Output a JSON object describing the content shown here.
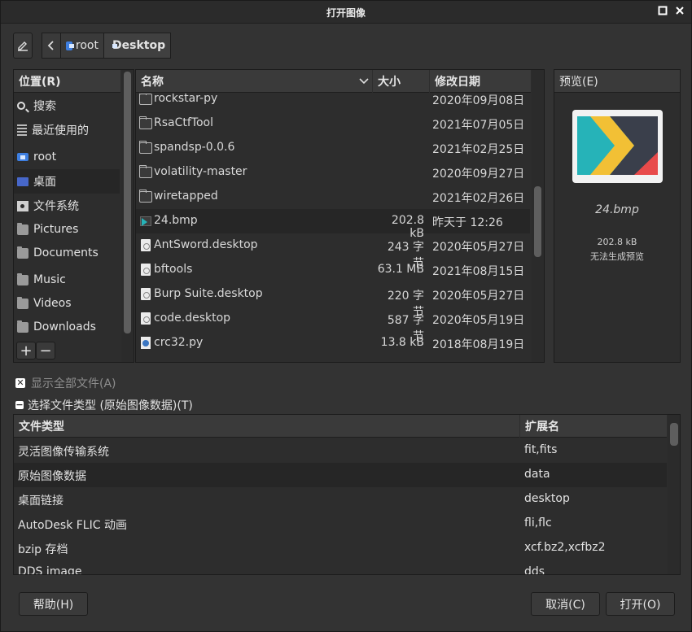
{
  "window": {
    "title": "打开图像"
  },
  "path": {
    "segments": [
      "root",
      "Desktop"
    ]
  },
  "sidebar": {
    "header": "位置(R)",
    "items": [
      {
        "label": "搜索",
        "icon": "search-icon"
      },
      {
        "label": "最近使用的",
        "icon": "recent-icon"
      },
      {
        "label": "root",
        "icon": "home-icon"
      },
      {
        "label": "桌面",
        "icon": "desktop-icon",
        "selected": true
      },
      {
        "label": "文件系统",
        "icon": "drive-icon"
      },
      {
        "label": "Pictures",
        "icon": "folder-icon"
      },
      {
        "label": "Documents",
        "icon": "folder-icon"
      },
      {
        "label": "Music",
        "icon": "folder-icon"
      },
      {
        "label": "Videos",
        "icon": "folder-icon"
      },
      {
        "label": "Downloads",
        "icon": "folder-icon"
      }
    ],
    "add_label": "+",
    "remove_label": "−"
  },
  "files": {
    "columns": {
      "name": "名称",
      "size": "大小",
      "date": "修改日期"
    },
    "rows": [
      {
        "name": "rockstar-py",
        "size": "",
        "date": "2020年09月08日",
        "icon": "folder"
      },
      {
        "name": "RsaCtfTool",
        "size": "",
        "date": "2021年07月05日",
        "icon": "folder"
      },
      {
        "name": "spandsp-0.0.6",
        "size": "",
        "date": "2021年02月25日",
        "icon": "folder"
      },
      {
        "name": "volatility-master",
        "size": "",
        "date": "2020年09月27日",
        "icon": "folder"
      },
      {
        "name": "wiretapped",
        "size": "",
        "date": "2021年02月26日",
        "icon": "folder"
      },
      {
        "name": "24.bmp",
        "size": "202.8 kB",
        "date": "昨天于 12:26",
        "icon": "img",
        "selected": true
      },
      {
        "name": "AntSword.desktop",
        "size": "243 字节",
        "date": "2020年05月27日",
        "icon": "doc"
      },
      {
        "name": "bftools",
        "size": "63.1 MB",
        "date": "2021年08月15日",
        "icon": "doc"
      },
      {
        "name": "Burp Suite.desktop",
        "size": "220 字节",
        "date": "2020年05月27日",
        "icon": "doc"
      },
      {
        "name": "code.desktop",
        "size": "587 字节",
        "date": "2020年05月19日",
        "icon": "doc"
      },
      {
        "name": "crc32.py",
        "size": "13.8 kB",
        "date": "2018年08月19日",
        "icon": "py"
      }
    ]
  },
  "preview": {
    "header": "预览(E)",
    "filename": "24.bmp",
    "size": "202.8 kB",
    "note": "无法生成预览"
  },
  "options": {
    "show_all": "显示全部文件(A)",
    "select_type": "选择文件类型 (原始图像数据)(T)"
  },
  "types": {
    "columns": {
      "type": "文件类型",
      "ext": "扩展名"
    },
    "rows": [
      {
        "type": "灵活图像传输系统",
        "ext": "fit,fits"
      },
      {
        "type": "原始图像数据",
        "ext": "data",
        "selected": true
      },
      {
        "type": "桌面链接",
        "ext": "desktop"
      },
      {
        "type": "AutoDesk FLIC 动画",
        "ext": "fli,flc"
      },
      {
        "type": "bzip 存档",
        "ext": "xcf.bz2,xcfbz2"
      },
      {
        "type": "DDS image",
        "ext": "dds"
      }
    ]
  },
  "buttons": {
    "help": "帮助(H)",
    "cancel": "取消(C)",
    "open": "打开(O)"
  }
}
